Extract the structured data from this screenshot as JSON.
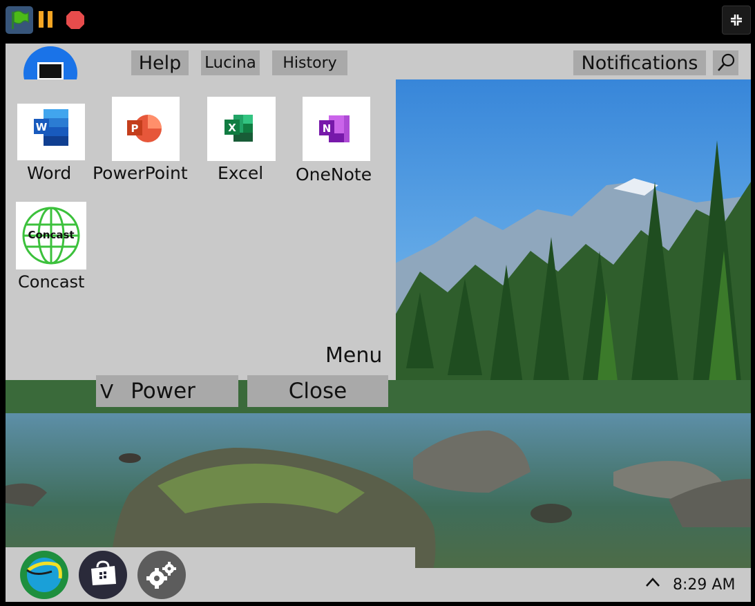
{
  "toolbar": {
    "flag_icon": "green-flag-icon",
    "pause_icon": "pause-icon",
    "stop_icon": "stop-icon",
    "fullscreen_icon": "exit-fullscreen-icon"
  },
  "header": {
    "help_label": "Help",
    "user_label": "Lucina",
    "history_label": "History",
    "notifications_label": "Notifications",
    "search_icon": "search-icon",
    "desktop_icon": "monitor-icon"
  },
  "menu": {
    "apps": [
      {
        "label": "Word"
      },
      {
        "label": "PowerPoint"
      },
      {
        "label": "Excel"
      },
      {
        "label": "OneNote"
      },
      {
        "label": "Concast",
        "logo_text": "Concast"
      }
    ],
    "title": "Menu",
    "power_chevron": "V",
    "power_label": "Power",
    "close_label": "Close"
  },
  "taskbar": {
    "icons": [
      "browser-icon",
      "store-icon",
      "settings-icon"
    ],
    "tray_chevron": "^",
    "clock": "8:29 AM"
  },
  "colors": {
    "panel": "#c9c9c9",
    "button": "#a9a9a9",
    "accent_blue": "#1a73e8",
    "concast_green": "#3cc13c"
  }
}
